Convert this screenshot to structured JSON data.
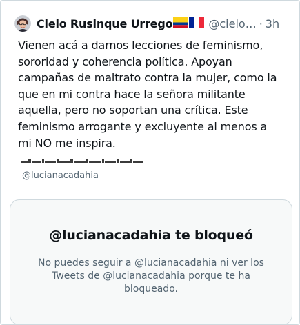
{
  "tweet": {
    "display_name": "Cielo Rusinque Urrego",
    "flags": [
      "colombia-flag-icon",
      "france-flag-icon"
    ],
    "handle": "@cielo…",
    "separator": "·",
    "timestamp": "3h",
    "text_lines": [
      "Vienen acá a darnos lecciones de feminismo,",
      "sororidad y coherencia política. Apoyan",
      "campañas de maltrato contra la mujer, como la",
      "que en mi contra hace la señora militante",
      "aquella, pero no soportan una crítica. Este",
      "feminismo arrogante y excluyente al menos a",
      "mi NO me inspira."
    ]
  },
  "quoted": {
    "handle": "@lucianacadahia"
  },
  "blocked_notice": {
    "title": "@lucianacadahia te bloqueó",
    "description_lines": [
      "No puedes seguir a @lucianacadahia ni ver los",
      "Tweets de @lucianacadahia porque te ha",
      "bloqueado."
    ]
  },
  "colors": {
    "text_primary": "#0f1419",
    "text_secondary": "#536471",
    "border": "#cfd9de",
    "card_background": "#f7f9f9"
  }
}
